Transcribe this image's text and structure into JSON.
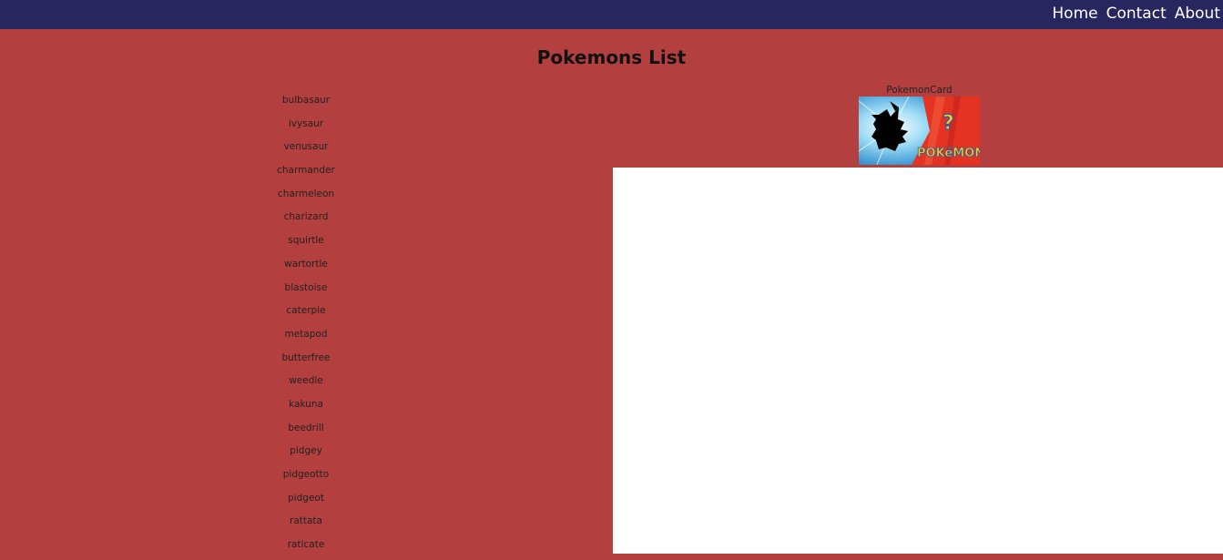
{
  "nav": {
    "links": [
      "Home",
      "Contact",
      "About"
    ]
  },
  "title": "Pokemons List",
  "pokemons": [
    "bulbasaur",
    "ivysaur",
    "venusaur",
    "charmander",
    "charmeleon",
    "charizard",
    "squirtle",
    "wartortle",
    "blastoise",
    "caterpie",
    "metapod",
    "butterfree",
    "weedle",
    "kakuna",
    "beedrill",
    "pidgey",
    "pidgeotto",
    "pidgeot",
    "rattata",
    "raticate"
  ],
  "card": {
    "label": "PokemonCard",
    "image_icon": "whos-that-pokemon-image"
  },
  "colors": {
    "navbar": "#28265f",
    "background": "#b33f3f",
    "panel": "#ffffff"
  }
}
